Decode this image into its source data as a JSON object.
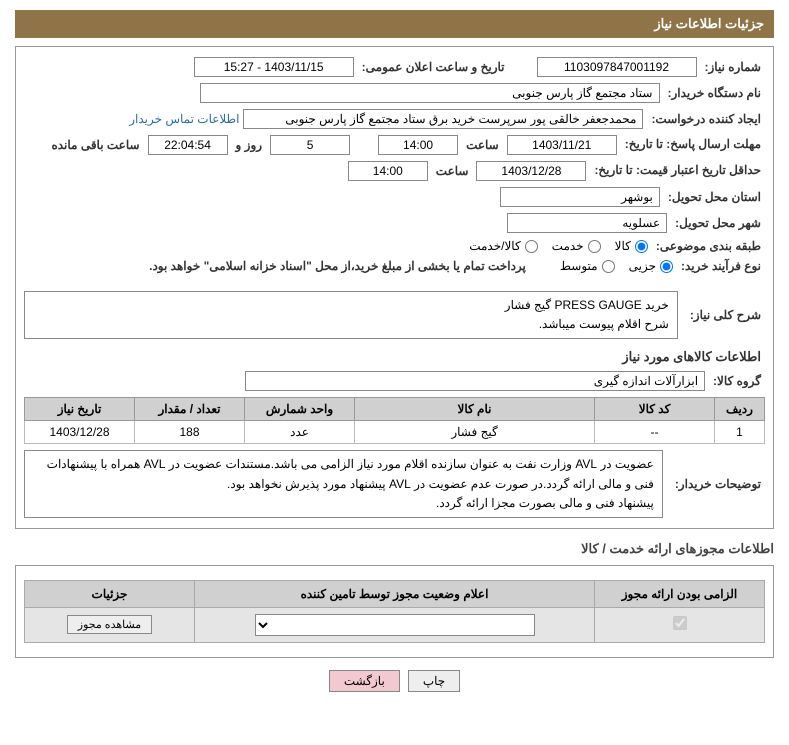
{
  "header": {
    "title": "جزئیات اطلاعات نیاز"
  },
  "fields": {
    "need_number_label": "شماره نیاز:",
    "need_number": "1103097847001192",
    "announce_datetime_label": "تاریخ و ساعت اعلان عمومی:",
    "announce_datetime": "1403/11/15 - 15:27",
    "buyer_org_label": "نام دستگاه خریدار:",
    "buyer_org": "ستاد مجتمع گاز پارس جنوبی",
    "requester_label": "ایجاد کننده درخواست:",
    "requester": "محمدجعفر خالقی پور سرپرست خرید برق ستاد مجتمع گاز پارس جنوبی",
    "buyer_contact_link": "اطلاعات تماس خریدار",
    "response_deadline_label": "مهلت ارسال پاسخ: تا تاریخ:",
    "response_deadline_date": "1403/11/21",
    "time_label": "ساعت",
    "response_deadline_time": "14:00",
    "days_and": "روز و",
    "days_value": "5",
    "countdown": "22:04:54",
    "remaining_label": "ساعت باقی مانده",
    "price_validity_label": "حداقل تاریخ اعتبار قیمت: تا تاریخ:",
    "price_validity_date": "1403/12/28",
    "price_validity_time": "14:00",
    "delivery_province_label": "استان محل تحویل:",
    "delivery_province": "بوشهر",
    "delivery_city_label": "شهر محل تحویل:",
    "delivery_city": "عسلویه",
    "subject_class_label": "طبقه بندی موضوعی:",
    "purchase_process_label": "نوع فرآیند خرید:",
    "payment_note": "پرداخت تمام یا بخشی از مبلغ خرید،از محل \"اسناد خزانه اسلامی\" خواهد بود.",
    "general_desc_label": "شرح کلی نیاز:",
    "general_desc": "خرید  PRESS GAUGE   گیج فشار\nشرح اقلام پیوست میباشد.",
    "goods_info_heading": "اطلاعات کالاهای مورد نیاز",
    "goods_group_label": "گروه کالا:",
    "goods_group": "ابزارآلات اندازه گیری",
    "buyer_notes_label": "توضیحات خریدار:",
    "buyer_notes": "عضویت در AVL وزارت نفت به عنوان سازنده اقلام مورد نیاز الزامی می باشد.مستندات عضویت در AVL همراه با پیشنهادات فنی و مالی ارائه گردد.در صورت عدم عضویت در AVL پیشنهاد مورد پذیرش نخواهد بود.\nپیشنهاد فنی و مالی بصورت مجزا ارائه گردد.",
    "license_heading": "اطلاعات مجوزهای ارائه خدمت / کالا"
  },
  "radios": {
    "subject": {
      "opt1": "کالا",
      "opt2": "خدمت",
      "opt3": "کالا/خدمت"
    },
    "process": {
      "opt1": "جزیی",
      "opt2": "متوسط"
    }
  },
  "table": {
    "headers": {
      "row": "ردیف",
      "code": "کد کالا",
      "name": "نام کالا",
      "unit": "واحد شمارش",
      "qty": "تعداد / مقدار",
      "need_date": "تاریخ نیاز"
    },
    "rows": [
      {
        "row": "1",
        "code": "--",
        "name": "گیج فشار",
        "unit": "عدد",
        "qty": "188",
        "need_date": "1403/12/28"
      }
    ]
  },
  "license_table": {
    "headers": {
      "mandatory": "الزامی بودن ارائه مجوز",
      "status": "اعلام وضعیت مجوز توسط تامین کننده",
      "details": "جزئیات"
    },
    "row": {
      "mandatory_checked": true,
      "status_selected": "",
      "details_btn": "مشاهده مجوز"
    }
  },
  "buttons": {
    "print": "چاپ",
    "back": "بازگشت"
  }
}
